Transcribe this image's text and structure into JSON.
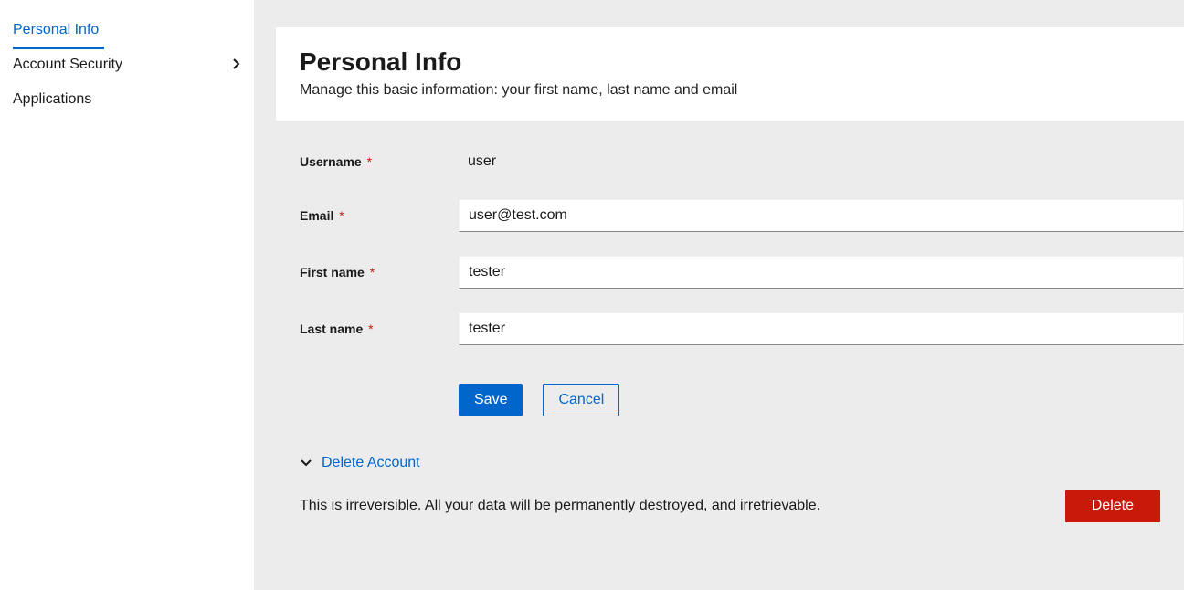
{
  "sidebar": {
    "items": [
      {
        "label": "Personal Info",
        "active": true,
        "expandable": false
      },
      {
        "label": "Account Security",
        "active": false,
        "expandable": true
      },
      {
        "label": "Applications",
        "active": false,
        "expandable": false
      }
    ]
  },
  "header": {
    "title": "Personal Info",
    "subtitle": "Manage this basic information: your first name, last name and email"
  },
  "form": {
    "username": {
      "label": "Username",
      "value": "user",
      "required": true
    },
    "email": {
      "label": "Email",
      "value": "user@test.com",
      "required": true
    },
    "firstname": {
      "label": "First name",
      "value": "tester",
      "required": true
    },
    "lastname": {
      "label": "Last name",
      "value": "tester",
      "required": true
    }
  },
  "buttons": {
    "save": "Save",
    "cancel": "Cancel"
  },
  "delete": {
    "title": "Delete Account",
    "warning": "This is irreversible. All your data will be permanently destroyed, and irretrievable.",
    "button": "Delete"
  },
  "glyphs": {
    "required": "*"
  }
}
